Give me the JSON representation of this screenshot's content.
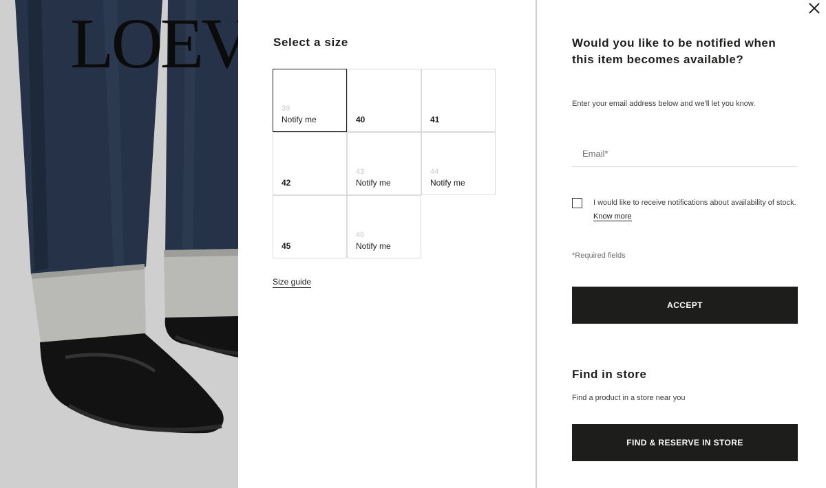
{
  "product": {
    "brand_logo": "LOEV"
  },
  "size_panel": {
    "title": "Select a size",
    "sizes": [
      {
        "size": "39",
        "available": false,
        "notify_label": "Notify me",
        "selected": true
      },
      {
        "size": "40",
        "available": true,
        "notify_label": "",
        "selected": false
      },
      {
        "size": "41",
        "available": true,
        "notify_label": "",
        "selected": false
      },
      {
        "size": "42",
        "available": true,
        "notify_label": "",
        "selected": false
      },
      {
        "size": "43",
        "available": false,
        "notify_label": "Notify me",
        "selected": false
      },
      {
        "size": "44",
        "available": false,
        "notify_label": "Notify me",
        "selected": false
      },
      {
        "size": "45",
        "available": true,
        "notify_label": "",
        "selected": false
      },
      {
        "size": "46",
        "available": false,
        "notify_label": "Notify me",
        "selected": false
      }
    ],
    "size_guide_label": "Size guide"
  },
  "notify_panel": {
    "heading": "Would you like to be notified when this item becomes available?",
    "subtext": "Enter your email address below and we'll let you know.",
    "email_placeholder": "Email*",
    "email_value": "",
    "consent_checked": false,
    "consent_text": "I would like to receive notifications about availability of stock.",
    "know_more_label": "Know more",
    "required_note": "*Required fields",
    "accept_label": "ACCEPT"
  },
  "store": {
    "heading": "Find in store",
    "subtext": "Find a product in a store near you",
    "button_label": "FIND & RESERVE IN STORE"
  },
  "colors": {
    "button_bg": "#1d1d1b",
    "cell_border": "#dadada",
    "unavailable_text": "#c9c9c9"
  }
}
